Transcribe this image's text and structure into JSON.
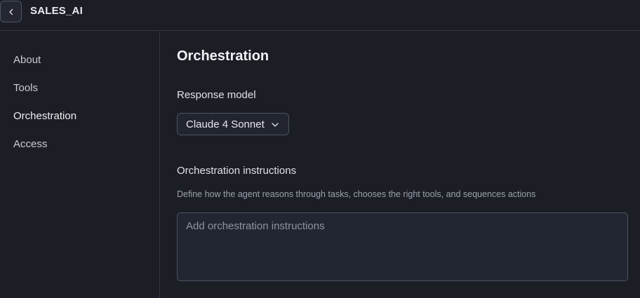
{
  "header": {
    "app_title": "SALES_AI",
    "back_icon": "chevron-left-icon"
  },
  "sidebar": {
    "items": [
      {
        "label": "About"
      },
      {
        "label": "Tools"
      },
      {
        "label": "Orchestration",
        "active": true
      },
      {
        "label": "Access"
      }
    ]
  },
  "main": {
    "title": "Orchestration",
    "response_model": {
      "label": "Response model",
      "selected": "Claude 4 Sonnet",
      "icon": "chevron-down-icon"
    },
    "instructions": {
      "label": "Orchestration instructions",
      "description": "Define how the agent reasons through tasks, chooses the right tools, and sequences actions",
      "placeholder": "Add orchestration instructions",
      "value": ""
    }
  },
  "colors": {
    "background": "#1c1e25",
    "border": "#4e5261",
    "text": "#e4e6eb",
    "muted": "#9ca1ad"
  }
}
